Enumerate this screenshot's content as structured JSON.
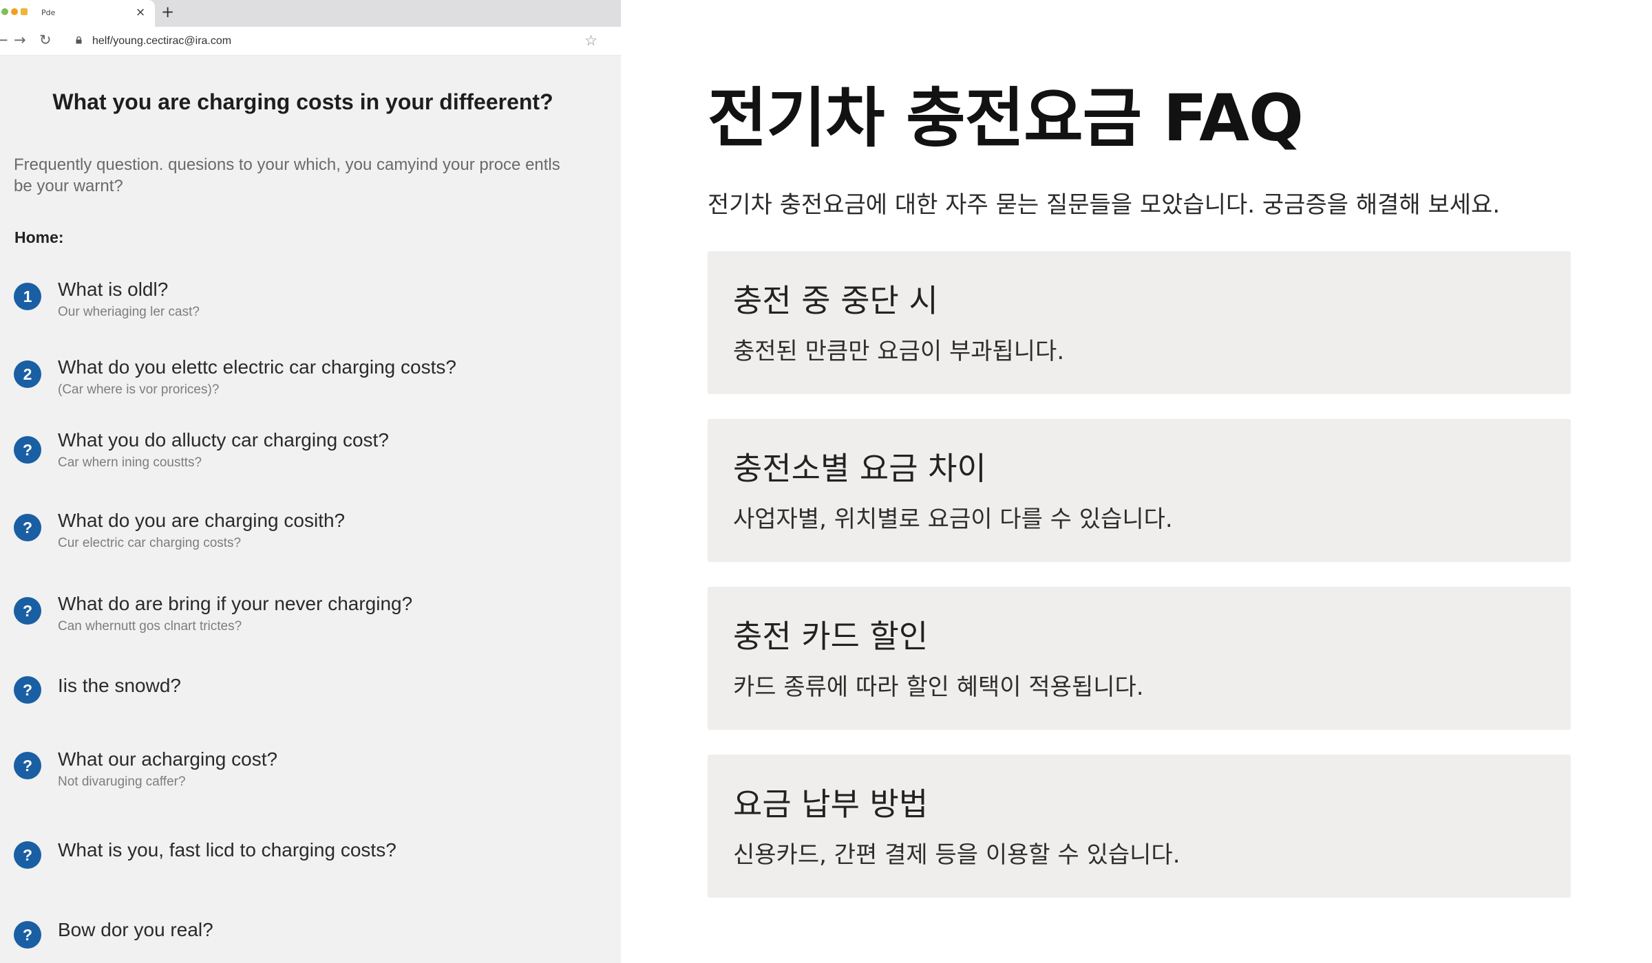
{
  "browser": {
    "tab_title": "Pde",
    "new_tab_label": "+",
    "close_label": "×",
    "url": "helf/young.cectirac@ira.com"
  },
  "left_page": {
    "title": "What you are charging costs in your diffeerent?",
    "intro": "Frequently question. quesions to your which, you camyind your proce entls be your warnt?",
    "section_label": "Home:",
    "items": [
      {
        "badge": "1",
        "question": "What is oldl?",
        "sub": "Our wheriaging ler cast?"
      },
      {
        "badge": "2",
        "question": "What do you elettc electric car charging costs?",
        "sub": "(Car where is vor prorices)?"
      },
      {
        "badge": "?",
        "question": "What you do allucty car charging cost?",
        "sub": "Car whern ining coustts?"
      },
      {
        "badge": "?",
        "question": "What do you are charging cosith?",
        "sub": "Cur electric car charging costs?"
      },
      {
        "badge": "?",
        "question": "What do are bring if your never charging?",
        "sub": "Can whernutt gos clnart trictes?"
      },
      {
        "badge": "?",
        "question": "Iis the snowd?",
        "sub": ""
      },
      {
        "badge": "?",
        "question": "What our acharging cost?",
        "sub": "Not divaruging caffer?"
      },
      {
        "badge": "?",
        "question": "What is you, fast licd to charging costs?",
        "sub": ""
      },
      {
        "badge": "?",
        "question": "Bow dor you real?",
        "sub": ""
      }
    ]
  },
  "right_page": {
    "title": "전기차 충전요금 FAQ",
    "intro": "전기차 충전요금에 대한 자주 묻는 질문들을 모았습니다. 궁금증을 해결해 보세요.",
    "cards": [
      {
        "title": "충전 중 중단 시",
        "text": "충전된 만큼만 요금이 부과됩니다."
      },
      {
        "title": "충전소별 요금 차이",
        "text": "사업자별, 위치별로 요금이 다를 수 있습니다."
      },
      {
        "title": "충전 카드 할인",
        "text": "카드 종류에 따라 할인 혜택이 적용됩니다."
      },
      {
        "title": "요금 납부 방법",
        "text": "신용카드, 간편 결제 등을 이용할 수 있습니다."
      }
    ]
  },
  "colors": {
    "badge": "#1a5fa3",
    "card_bg": "#f0eeed",
    "left_bg": "#f1f1f1"
  }
}
